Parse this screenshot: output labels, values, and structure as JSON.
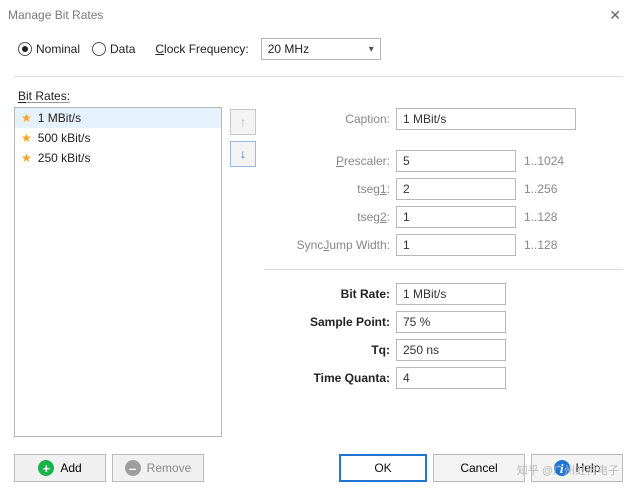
{
  "window": {
    "title": "Manage Bit Rates",
    "close": "✕"
  },
  "mode": {
    "nominal": "Nominal",
    "data": "Data",
    "clock_label": "Clock Frequency:",
    "clock_value": "20 MHz"
  },
  "list": {
    "label": "Bit Rates:",
    "items": [
      {
        "label": "1 MBit/s",
        "selected": true
      },
      {
        "label": "500 kBit/s",
        "selected": false
      },
      {
        "label": "250 kBit/s",
        "selected": false
      }
    ]
  },
  "arrows": {
    "up": "↑",
    "down": "↓"
  },
  "form": {
    "caption_label": "Caption:",
    "caption_value": "1 MBit/s",
    "prescaler_label": "Prescaler:",
    "prescaler_value": "5",
    "prescaler_range": "1..1024",
    "tseg1_label": "tseg1:",
    "tseg1_value": "2",
    "tseg1_range": "1..256",
    "tseg2_label": "tseg2:",
    "tseg2_value": "1",
    "tseg2_range": "1..128",
    "sjw_label": "SyncJump Width:",
    "sjw_value": "1",
    "sjw_range": "1..128",
    "bitrate_label": "Bit Rate:",
    "bitrate_value": "1 MBit/s",
    "sp_label": "Sample Point:",
    "sp_value": "75 %",
    "tq_label": "Tq:",
    "tq_value": "250 ns",
    "tquanta_label": "Time Quanta:",
    "tquanta_value": "4"
  },
  "buttons": {
    "add": "Add",
    "remove": "Remove",
    "ok": "OK",
    "cancel": "Cancel",
    "help": "Help"
  },
  "watermark": "知乎 @广州虹科电子"
}
